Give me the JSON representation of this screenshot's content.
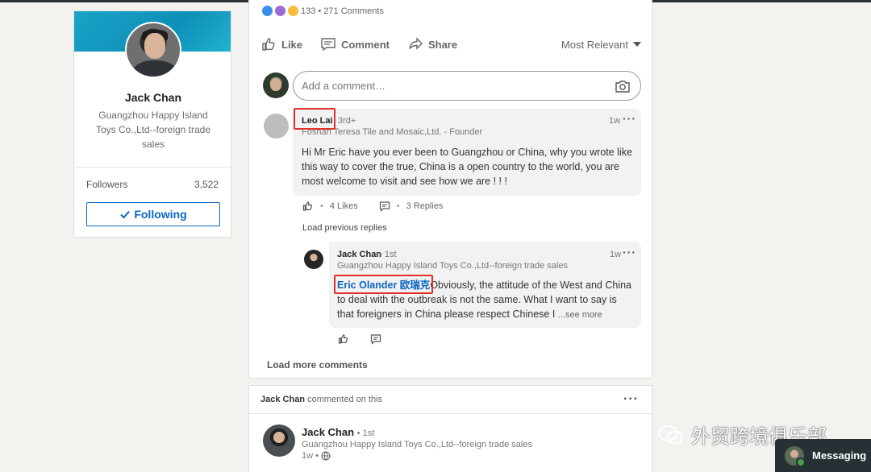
{
  "profile": {
    "name": "Jack Chan",
    "headline": "Guangzhou Happy Island Toys Co.,Ltd--foreign trade sales",
    "followers_label": "Followers",
    "followers_count": "3,522",
    "following_button": "Following"
  },
  "post": {
    "reactions_summary": "133 • 271 Comments",
    "actions": {
      "like": "Like",
      "comment": "Comment",
      "share": "Share"
    },
    "sort_label": "Most Relevant",
    "comment_placeholder": "Add a comment…",
    "comments": [
      {
        "author": "Leo Lai",
        "degree": "3rd+",
        "subtitle": "Foshan Teresa Tile and Mosaic,Ltd. - Founder",
        "time": "1w",
        "text": "Hi Mr Eric have you ever been to Guangzhou or China, why you wrote like this way to cover the true, China is a open country to the world, you are most welcome to visit and see how we are ! ! !",
        "likes": "4 Likes",
        "replies": "3 Replies"
      }
    ],
    "load_previous": "Load previous replies",
    "reply": {
      "author": "Jack Chan",
      "degree": "• 1st",
      "subtitle": "Guangzhou Happy Island Toys Co.,Ltd--foreign trade sales",
      "time": "1w",
      "mention": "Eric Olander 欧瑞克",
      "text": "Obviously, the attitude of the West and China to deal with the outbreak is not the same. What I want to say is that foreigners in China please respect Chinese I",
      "see_more": "...see more"
    },
    "load_more": "Load more comments"
  },
  "post2": {
    "header_name": "Jack Chan",
    "header_text": "commented on this",
    "author": "Jack Chan",
    "degree": "• 1st",
    "subtitle": "Guangzhou Happy Island Toys Co.,Ltd--foreign trade sales",
    "time": "1w •"
  },
  "watermark": "外贸跨境俱乐部",
  "messaging_label": "Messaging",
  "colors": {
    "accent": "#0a66c2",
    "highlight_box": "#e0302a",
    "messaging_bg": "#273034"
  }
}
